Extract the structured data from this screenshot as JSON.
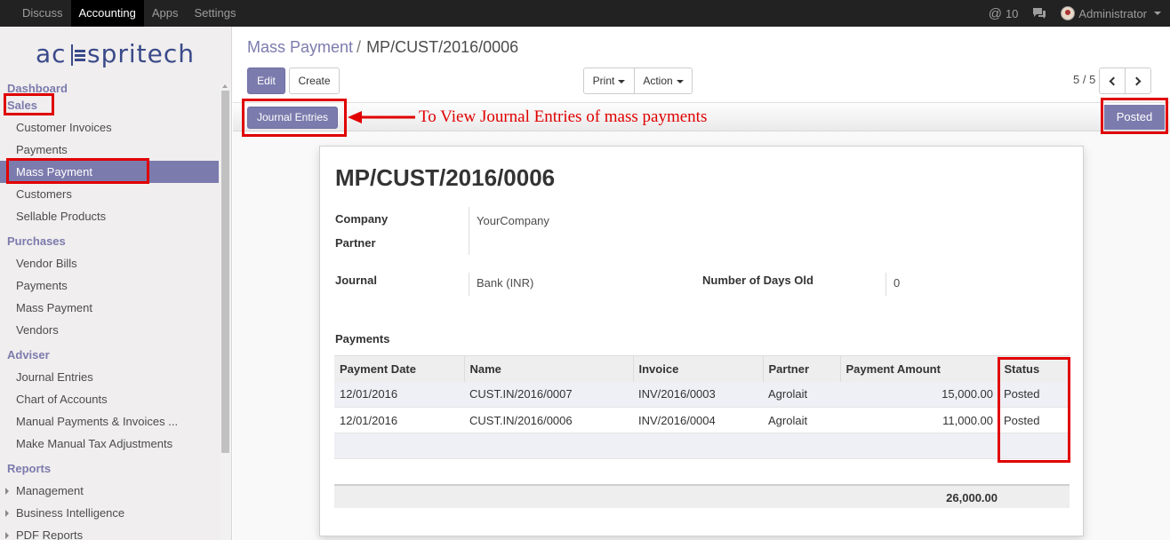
{
  "topbar": {
    "apps": [
      "Discuss",
      "Accounting",
      "Apps",
      "Settings"
    ],
    "active_app": "Accounting",
    "messages_count": "10",
    "user": "Administrator"
  },
  "sidebar": {
    "logo_text": "acsspritech",
    "sections": [
      {
        "title": "Dashboard",
        "items": []
      },
      {
        "title": "Sales",
        "items": [
          "Customer Invoices",
          "Payments",
          "Mass Payment",
          "Customers",
          "Sellable Products"
        ]
      },
      {
        "title": "Purchases",
        "items": [
          "Vendor Bills",
          "Payments",
          "Mass Payment",
          "Vendors"
        ]
      },
      {
        "title": "Adviser",
        "items": [
          "Journal Entries",
          "Chart of Accounts",
          "Manual Payments & Invoices ...",
          "Make Manual Tax Adjustments"
        ]
      },
      {
        "title": "Reports",
        "items": [
          "Management",
          "Business Intelligence",
          "PDF Reports"
        ]
      }
    ],
    "active_item": "Mass Payment"
  },
  "breadcrumb": {
    "parent": "Mass Payment",
    "separator": "/",
    "current": "MP/CUST/2016/0006"
  },
  "buttons": {
    "edit": "Edit",
    "create": "Create",
    "print": "Print",
    "action": "Action",
    "journal_entries": "Journal Entries"
  },
  "pager": {
    "value": "5 / 5"
  },
  "status": {
    "current": "Posted"
  },
  "annotation": "To View Journal Entries of mass payments",
  "form": {
    "title": "MP/CUST/2016/0006",
    "company_label": "Company",
    "company_value": "YourCompany",
    "partner_label": "Partner",
    "partner_value": "",
    "journal_label": "Journal",
    "journal_value": "Bank (INR)",
    "days_old_label": "Number of Days Old",
    "days_old_value": "0",
    "payments_label": "Payments"
  },
  "payments_table": {
    "columns": [
      "Payment Date",
      "Name",
      "Invoice",
      "Partner",
      "Payment Amount",
      "Status"
    ],
    "rows": [
      [
        "12/01/2016",
        "CUST.IN/2016/0007",
        "INV/2016/0003",
        "Agrolait",
        "15,000.00",
        "Posted"
      ],
      [
        "12/01/2016",
        "CUST.IN/2016/0006",
        "INV/2016/0004",
        "Agrolait",
        "11,000.00",
        "Posted"
      ]
    ],
    "total": "26,000.00"
  },
  "colors": {
    "accent": "#7c7bad",
    "highlight": "#e00000",
    "topbar": "#222222"
  }
}
